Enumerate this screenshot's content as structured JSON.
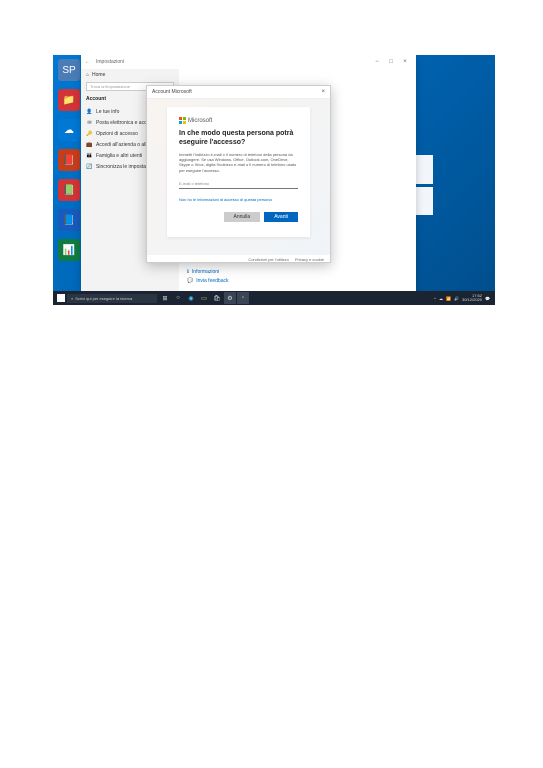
{
  "settings": {
    "window_title": "Impostazioni",
    "home": "Home",
    "search_placeholder": "Trova un'impostazione",
    "section": "Account",
    "items": [
      {
        "icon": "👤",
        "label": "Le tue info"
      },
      {
        "icon": "✉",
        "label": "Posta elettronica e account"
      },
      {
        "icon": "🔑",
        "label": "Opzioni di accesso"
      },
      {
        "icon": "💼",
        "label": "Accedi all'azienda o all'istituto..."
      },
      {
        "icon": "👪",
        "label": "Famiglia e altri utenti"
      },
      {
        "icon": "🔄",
        "label": "Sincronizza le impostazioni"
      }
    ],
    "footer": [
      {
        "icon": "ℹ",
        "label": "Informazioni"
      },
      {
        "icon": "💬",
        "label": "Invia feedback"
      }
    ]
  },
  "modal": {
    "title": "Account Microsoft",
    "brand": "Microsoft",
    "heading": "In che modo questa persona potrà eseguire l'accesso?",
    "description": "Immetti l'indirizzo e-mail o il numero di telefono della persona da aggiungere. Se usa Windows, Office, Outlook.com, OneDrive, Skype o Xbox, digita l'indirizzo e-mail o il numero di telefono usato per eseguire l'accesso.",
    "placeholder": "E-mail o telefono",
    "link": "Non ho le informazioni di accesso di questa persona",
    "cancel": "Annulla",
    "next": "Avanti",
    "footer_terms": "Condizioni per l'utilizzo",
    "footer_privacy": "Privacy e cookie"
  },
  "taskbar": {
    "search": "Scrivi qui per eseguire la ricerca",
    "time": "17:52",
    "date": "30/12/2020"
  },
  "desktop_icons": [
    "SP",
    "📁",
    "☁",
    "📕",
    "📗",
    "📘",
    "📊"
  ]
}
